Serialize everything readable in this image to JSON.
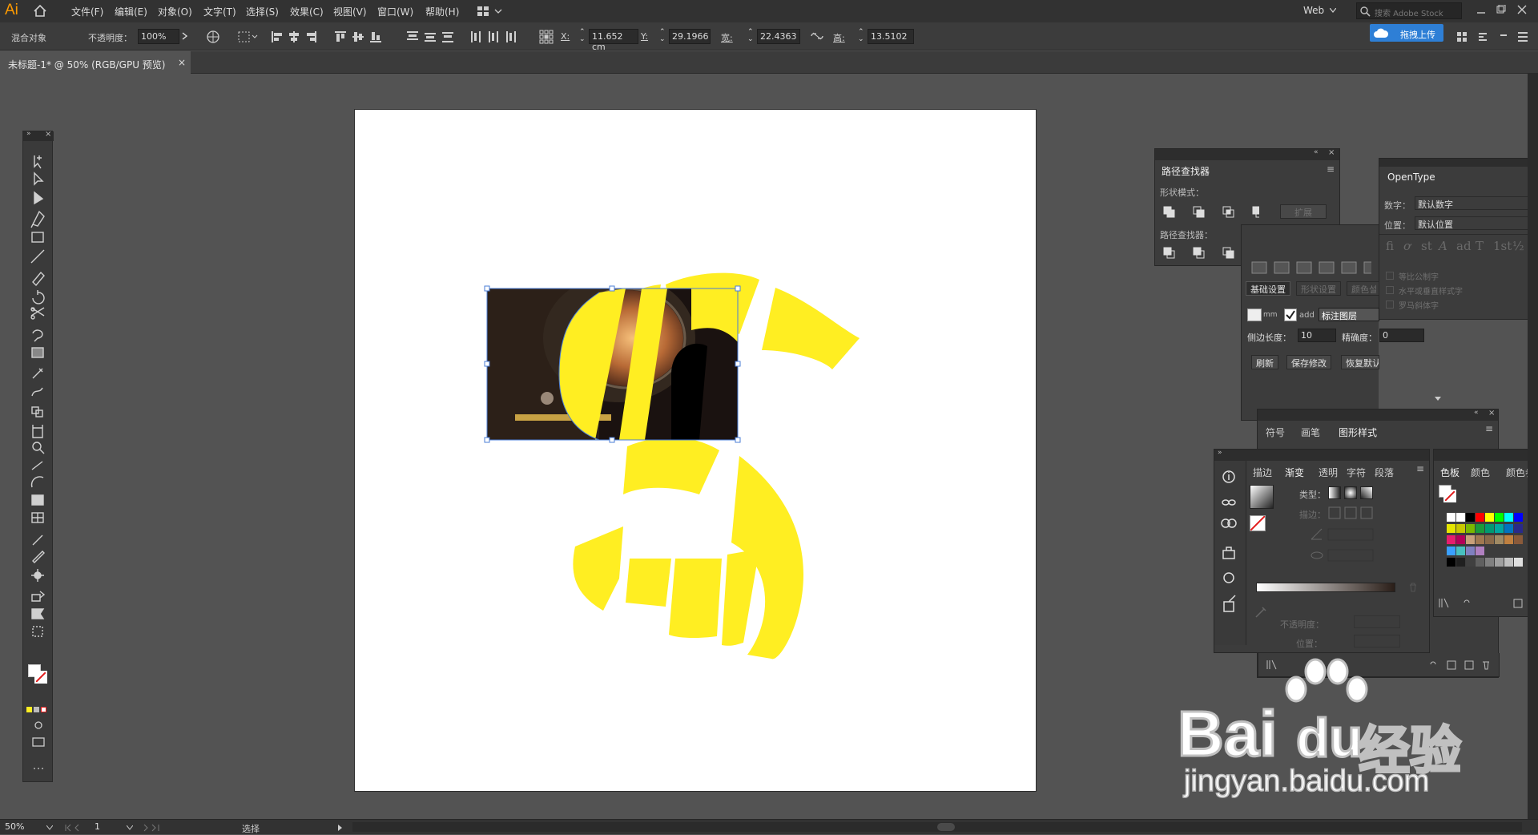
{
  "app": {
    "logo": "Ai"
  },
  "menu": {
    "items": [
      "文件(F)",
      "编辑(E)",
      "对象(O)",
      "文字(T)",
      "选择(S)",
      "效果(C)",
      "视图(V)",
      "窗口(W)",
      "帮助(H)"
    ],
    "workspace": "Web",
    "search_placeholder": "搜索 Adobe Stock",
    "upload_label": "拖拽上传"
  },
  "control": {
    "object_type": "混合对象",
    "opacity_label": "不透明度：",
    "opacity_value": "100%",
    "x_label": "X:",
    "x_value": "11.652 cm",
    "y_label": "Y:",
    "y_value": "29.1966",
    "w_label": "宽:",
    "w_value": "22.4363",
    "h_label": "高:",
    "h_value": "13.5102"
  },
  "document": {
    "tab_title": "未标题-1* @ 50% (RGB/GPU 预览)"
  },
  "pathfinder": {
    "title": "路径查找器",
    "shape_modes": "形状模式：",
    "expand": "扩展",
    "pathfinders": "路径查找器："
  },
  "opentype": {
    "title": "OpenType",
    "figure_label": "数字：",
    "figure_value": "默认数字",
    "position_label": "位置：",
    "position_value": "默认位置",
    "opt1": "等比公制字",
    "opt2": "水平或垂直样式字",
    "opt3": "罗马斜体字"
  },
  "plugin": {
    "tab_basic": "基础设置",
    "tab_shape": "形状设置",
    "tab_color": "颜色설",
    "unit": "mm",
    "add": "add",
    "layer": "标注图层",
    "side_label": "侧边长度：",
    "side_value": "10",
    "precision_label": "精确度：",
    "precision_value": "0",
    "refresh": "刷新",
    "save": "保存修改",
    "reset": "恢复默认"
  },
  "symbols_panel": {
    "tabs": [
      "符号",
      "画笔",
      "图形样式"
    ]
  },
  "gradient_panel": {
    "tabs": [
      "描边",
      "渐变",
      "透明",
      "字符",
      "段落"
    ],
    "type_label": "类型：",
    "stroke_label": "描边：",
    "opacity_label": "不透明度：",
    "position_label": "位置："
  },
  "swatch_panel": {
    "tabs": [
      "色板",
      "颜色",
      "颜色参考"
    ]
  },
  "status": {
    "zoom": "50%",
    "page": "1",
    "tool": "选择"
  },
  "watermark": {
    "brand": "Bai",
    "du": "du",
    "jy": "经验",
    "url": "jingyan.baidu.com"
  },
  "colors": {
    "accent_yellow": "#ffee22",
    "selection": "#4a7cd6",
    "ui_dark": "#535353"
  }
}
